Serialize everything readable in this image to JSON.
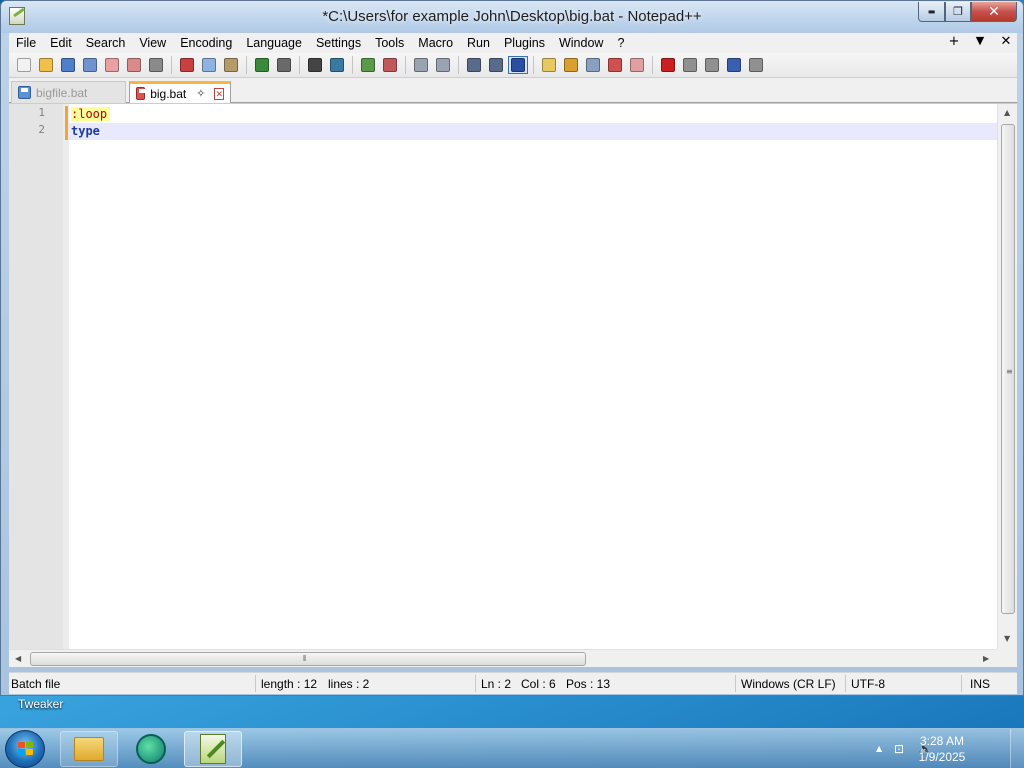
{
  "window": {
    "title": "*C:\\Users\\for example John\\Desktop\\big.bat - Notepad++",
    "min_glyph": "▬",
    "max_glyph": "❐",
    "close_glyph": "✕"
  },
  "menu": {
    "items": [
      "File",
      "Edit",
      "Search",
      "View",
      "Encoding",
      "Language",
      "Settings",
      "Tools",
      "Macro",
      "Run",
      "Plugins",
      "Window",
      "?"
    ],
    "right": [
      "+",
      "▼",
      "✕"
    ]
  },
  "toolbar": {
    "buttons": [
      {
        "name": "new-file",
        "color": "#f2f2f2"
      },
      {
        "name": "open-file",
        "color": "#f0c04a"
      },
      {
        "name": "save",
        "color": "#4f7fc9"
      },
      {
        "name": "save-all",
        "color": "#6f93cf"
      },
      {
        "name": "close",
        "color": "#e8a0a0"
      },
      {
        "name": "close-all",
        "color": "#d98a8a"
      },
      {
        "name": "print",
        "color": "#8a8a8a"
      },
      {
        "name": "cut",
        "color": "#c94040"
      },
      {
        "name": "copy",
        "color": "#8fb3e0"
      },
      {
        "name": "paste",
        "color": "#b59a6a"
      },
      {
        "name": "undo",
        "color": "#3b8a3b"
      },
      {
        "name": "redo",
        "color": "#6a6a6a"
      },
      {
        "name": "find",
        "color": "#444444"
      },
      {
        "name": "replace",
        "color": "#3a7aa0"
      },
      {
        "name": "zoom-in",
        "color": "#5a9a4a"
      },
      {
        "name": "zoom-out",
        "color": "#c05a5a"
      },
      {
        "name": "sync-vertical",
        "color": "#9aa4b0"
      },
      {
        "name": "sync-horizontal",
        "color": "#9aa4b0"
      },
      {
        "name": "word-wrap",
        "color": "#5a6a8a"
      },
      {
        "name": "show-all-characters",
        "color": "#5a6a8a"
      },
      {
        "name": "indent-guide",
        "color": "#2a4fa0"
      },
      {
        "name": "user-defined-language",
        "color": "#e8c860"
      },
      {
        "name": "document-map",
        "color": "#d9a030"
      },
      {
        "name": "function-list",
        "color": "#8aa0c0"
      },
      {
        "name": "folder-as-workspace",
        "color": "#d05050"
      },
      {
        "name": "monitoring",
        "color": "#e0a0a0"
      },
      {
        "name": "macro-start-recording",
        "color": "#cc2020"
      },
      {
        "name": "macro-stop-recording",
        "color": "#909090"
      },
      {
        "name": "macro-playback",
        "color": "#909090"
      },
      {
        "name": "macro-run-multiple",
        "color": "#3a5fb0"
      },
      {
        "name": "macro-save",
        "color": "#909090"
      }
    ]
  },
  "tabs": [
    {
      "label": "bigfile.bat",
      "active": false
    },
    {
      "label": "big.bat",
      "active": true
    }
  ],
  "tab_pin_glyph": "✧",
  "tab_close_glyph": "✕",
  "editor": {
    "lines": [
      {
        "number": "1",
        "text": ":loop",
        "style": "label"
      },
      {
        "number": "2",
        "text": "type",
        "style": "keyword"
      }
    ]
  },
  "scroll": {
    "up": "▲",
    "down": "▼",
    "left": "◀",
    "right": "▶",
    "grip_v": "≡",
    "grip_h": "⦀"
  },
  "status": {
    "file_type": "Batch file",
    "length": "length : 12",
    "lines": "lines : 2",
    "ln": "Ln : 2",
    "col": "Col : 6",
    "pos": "Pos : 13",
    "eol": "Windows (CR LF)",
    "encoding": "UTF-8",
    "mode": "INS"
  },
  "desktop": {
    "label": "Tweaker"
  },
  "taskbar": {
    "time": "3:28 AM",
    "date": "1/9/2025",
    "tray_arrow": "▲",
    "tray_network": "⊡",
    "tray_volume": "🔈"
  }
}
